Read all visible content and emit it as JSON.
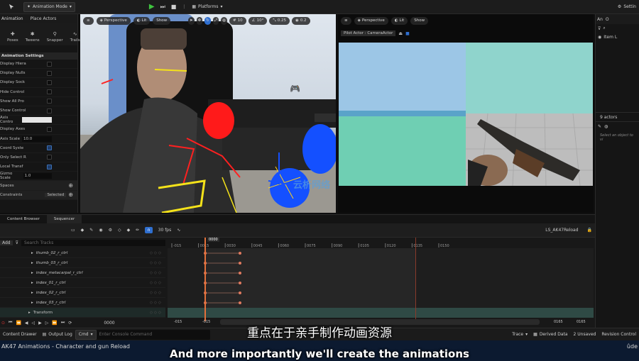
{
  "toolbar": {
    "mode_label": "Animation Mode",
    "platforms_label": "Platforms",
    "settings_label": "Settin"
  },
  "left_panel": {
    "tabs": [
      "Animation",
      "Place Actors"
    ],
    "mode_buttons": [
      "Poses",
      "Tweens",
      "Snapper",
      "Trails"
    ],
    "section_title": "Animation Settings",
    "rows": [
      {
        "label": "Display Hiera",
        "control": "check",
        "on": false
      },
      {
        "label": "Display Nulls",
        "control": "check",
        "on": false
      },
      {
        "label": "Display Sock",
        "control": "check",
        "on": false
      },
      {
        "label": "Hide Control",
        "control": "check",
        "on": false
      },
      {
        "label": "Show All Pro",
        "control": "check",
        "on": false
      },
      {
        "label": "Show Control",
        "control": "check",
        "on": false
      },
      {
        "label": "Axis Contro",
        "control": "color",
        "on": false
      },
      {
        "label": "Display Axes",
        "control": "check",
        "on": false
      },
      {
        "label": "Axis Scale",
        "control": "value",
        "value": "10.0"
      },
      {
        "label": "Coord Syste",
        "control": "check",
        "on": true
      },
      {
        "label": "Only Select R",
        "control": "check",
        "on": false
      },
      {
        "label": "Local Transf",
        "control": "check",
        "on": true
      },
      {
        "label": "Gizmo Scale",
        "control": "value",
        "value": "1.0"
      }
    ],
    "spaces_label": "Spaces",
    "constraints_label": "Constraints",
    "selected_label": "Selected"
  },
  "left_viewport": {
    "perspective_label": "Perspective",
    "lit_label": "Lit",
    "show_label": "Show",
    "snap_values": [
      "10",
      "10°",
      "0.25",
      "0.2"
    ]
  },
  "right_viewport": {
    "perspective_label": "Perspective",
    "lit_label": "Lit",
    "show_label": "Show",
    "pilot_label": "Pilot Actor : CameraActor"
  },
  "watermark": "云析网络",
  "right_panel": {
    "tabs": [
      "An",
      "O"
    ],
    "item_label": "Item L",
    "actors_count": "9 actors",
    "details_hint": "Select an object to vi"
  },
  "sequencer": {
    "tabs": [
      "Content Browser",
      "Sequencer"
    ],
    "fps": "30 fps",
    "sequence_name": "LS_AK47Reload",
    "add_label": "Add",
    "search_placeholder": "Search Tracks",
    "tracks": [
      "thumb_02_r_ctrl",
      "thumb_03_r_ctrl",
      "index_metacarpal_r_ctrl",
      "index_01_r_ctrl",
      "index_02_r_ctrl",
      "index_03_r_ctrl",
      "Transform"
    ],
    "ruler_labels": [
      "-015",
      "0015",
      "0030",
      "0045",
      "0060",
      "0075",
      "0090",
      "0105",
      "0120",
      "0135",
      "0150"
    ],
    "playhead_frame": "0000",
    "current_frame": "0000",
    "range_start": "-015",
    "range_left": "-015",
    "range_right_a": "0165",
    "range_right_b": "0165"
  },
  "statusbar": {
    "drawer": "Content Drawer",
    "output_log": "Output Log",
    "cmd": "Cmd",
    "console_placeholder": "Enter Console Command",
    "trace": "Trace",
    "derived_data": "Derived Data",
    "unsaved": "2 Unsaved",
    "revision": "Revision Control"
  },
  "window_title": "AK47 Animations - Character and gun Reload",
  "window_brand": "ûde",
  "subtitles": {
    "chinese": "重点在于亲手制作动画资源",
    "english": "And more importantly we'll create the animations"
  },
  "colors": {
    "accent_blue": "#2f6fd0",
    "keyframe": "#e07a5f",
    "playhead": "#e2703a",
    "gizmo_red": "#ff1a1a",
    "gizmo_blue": "#1450ff"
  }
}
